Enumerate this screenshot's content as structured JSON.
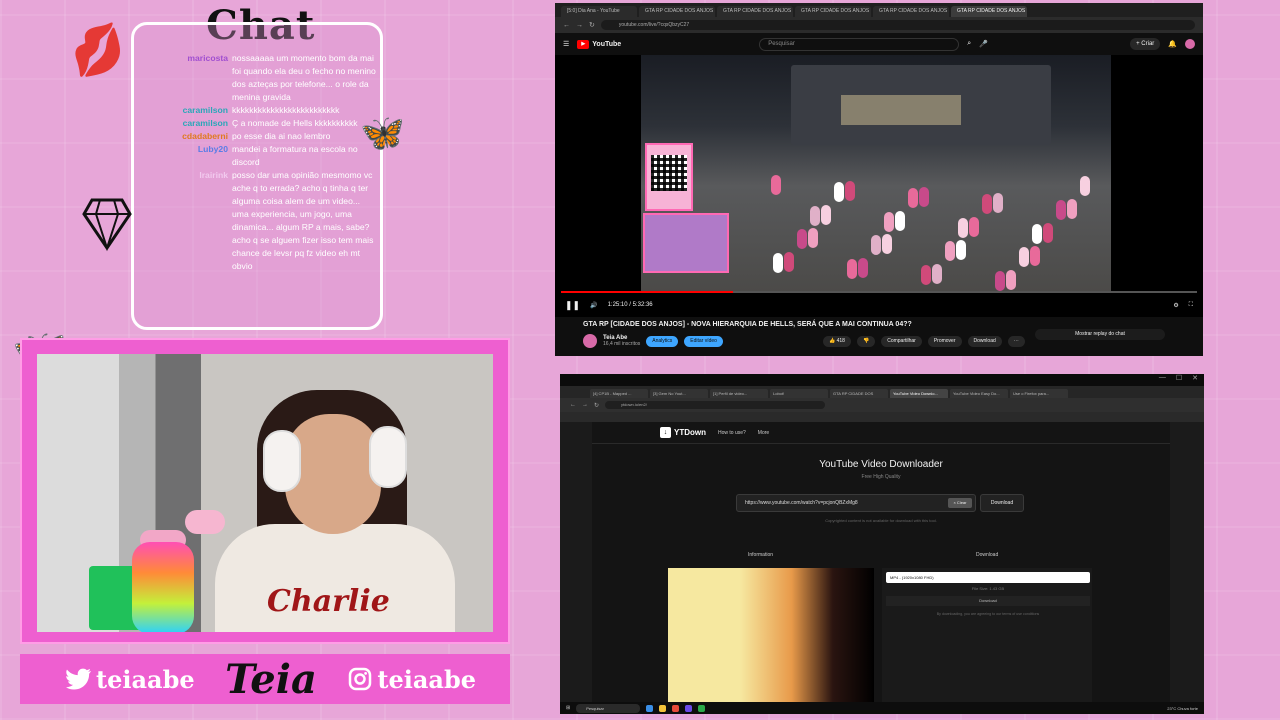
{
  "chat": {
    "title": "Chat",
    "messages": [
      {
        "user": "maricosta",
        "color": "#a04fd0",
        "text": "nossaaaaa um momento bom da mai foi quando ela deu o fecho no menino dos azteças por telefone... o role da menina gravida"
      },
      {
        "user": "caramilson",
        "color": "#2aa7b8",
        "text": "kkkkkkkkkkkkkkkkkkkkkkkkk"
      },
      {
        "user": "caramilson",
        "color": "#2aa7b8",
        "text": "Ç a nomade de Hells kkkkkkkkkk"
      },
      {
        "user": "cdadaberni",
        "color": "#e07a1f",
        "text": "po esse dia ai nao lembro"
      },
      {
        "user": "Luby20",
        "color": "#5a7de6",
        "text": "mandei a formatura na escola no discord"
      },
      {
        "user": "Irairink",
        "color": "#f2c9ee",
        "text": "posso dar uma opinião mesmomo vc ache q to errada? acho q tinha q ter alguma coisa alem de um video... uma experiencia, um jogo, uma dinamica... algum RP a mais, sabe? acho q se alguem fizer isso tem mais chance de levsr pq fz video eh mt obvio"
      }
    ]
  },
  "brand": {
    "twitter_handle": "teiaabe",
    "logo_text": "Teia",
    "instagram_handle": "teiaabe"
  },
  "webcam": {
    "shirt_text": "Charlie"
  },
  "youtube": {
    "tabs": [
      "[5:0] Dia Ana - YouTube",
      "GTA RP CIDADE DOS ANJOS",
      "GTA RP CIDADE DOS ANJOS",
      "GTA RP CIDADE DOS ANJOS",
      "GTA RP CIDADE DOS ANJOS",
      "GTA RP CIDADE DOS ANJOS"
    ],
    "url": "youtube.com/live/?cqsQbzyC27",
    "logo": "YouTube",
    "search_placeholder": "Pesquisar",
    "create_label": "+ Criar",
    "time": "1:25:10 / 5:32:36",
    "progress": 0.27,
    "title": "GTA RP [CIDADE DOS ANJOS] - NOVA HIERARQUIA DE HELLS, SERÁ QUE A MAI CONTINUA 04??",
    "channel": "Teia Abe",
    "subscribers": "16,4 mil inscritos",
    "analytics_label": "Analytics",
    "edit_label": "Editar vídeo",
    "likes": "418",
    "share_label": "Compartilhar",
    "promote_label": "Promover",
    "download_label": "Download",
    "replay_label": "Mostrar replay do chat"
  },
  "ytdown": {
    "tabs": [
      "[4] CP1B - Mapped ...",
      "[3] Gem No Yout...",
      "[1] Perfil de video...",
      "Lobot!",
      "GTA RP CIDADE DOS",
      "YouTube Video Downlo...",
      "YouTube Video Easy Do...",
      "Use o Firefox para..."
    ],
    "url": "ytdown.io/en2/",
    "logo": "YTDown",
    "nav_how": "How to use?",
    "nav_more": "More",
    "title": "YouTube Video Downloader",
    "subtitle": "Free High Quality",
    "input_value": "https://www.youtube.com/watch?v=pcjonQBZxMg8",
    "clear_label": "× Clear",
    "download_button": "Download",
    "note": "Copyrighted content is not available for download with this tool.",
    "info_heading": "Information",
    "download_heading": "Download",
    "format_option": "MP4 - (1920x1080 FHD)",
    "file_size": "File Size: 1.43 GB",
    "download_row": "Download",
    "terms": "By downloading, you are agreeing to our terms of use conditions",
    "taskbar_search": "Pesquisar",
    "weather": "23°C Chuva forte"
  }
}
